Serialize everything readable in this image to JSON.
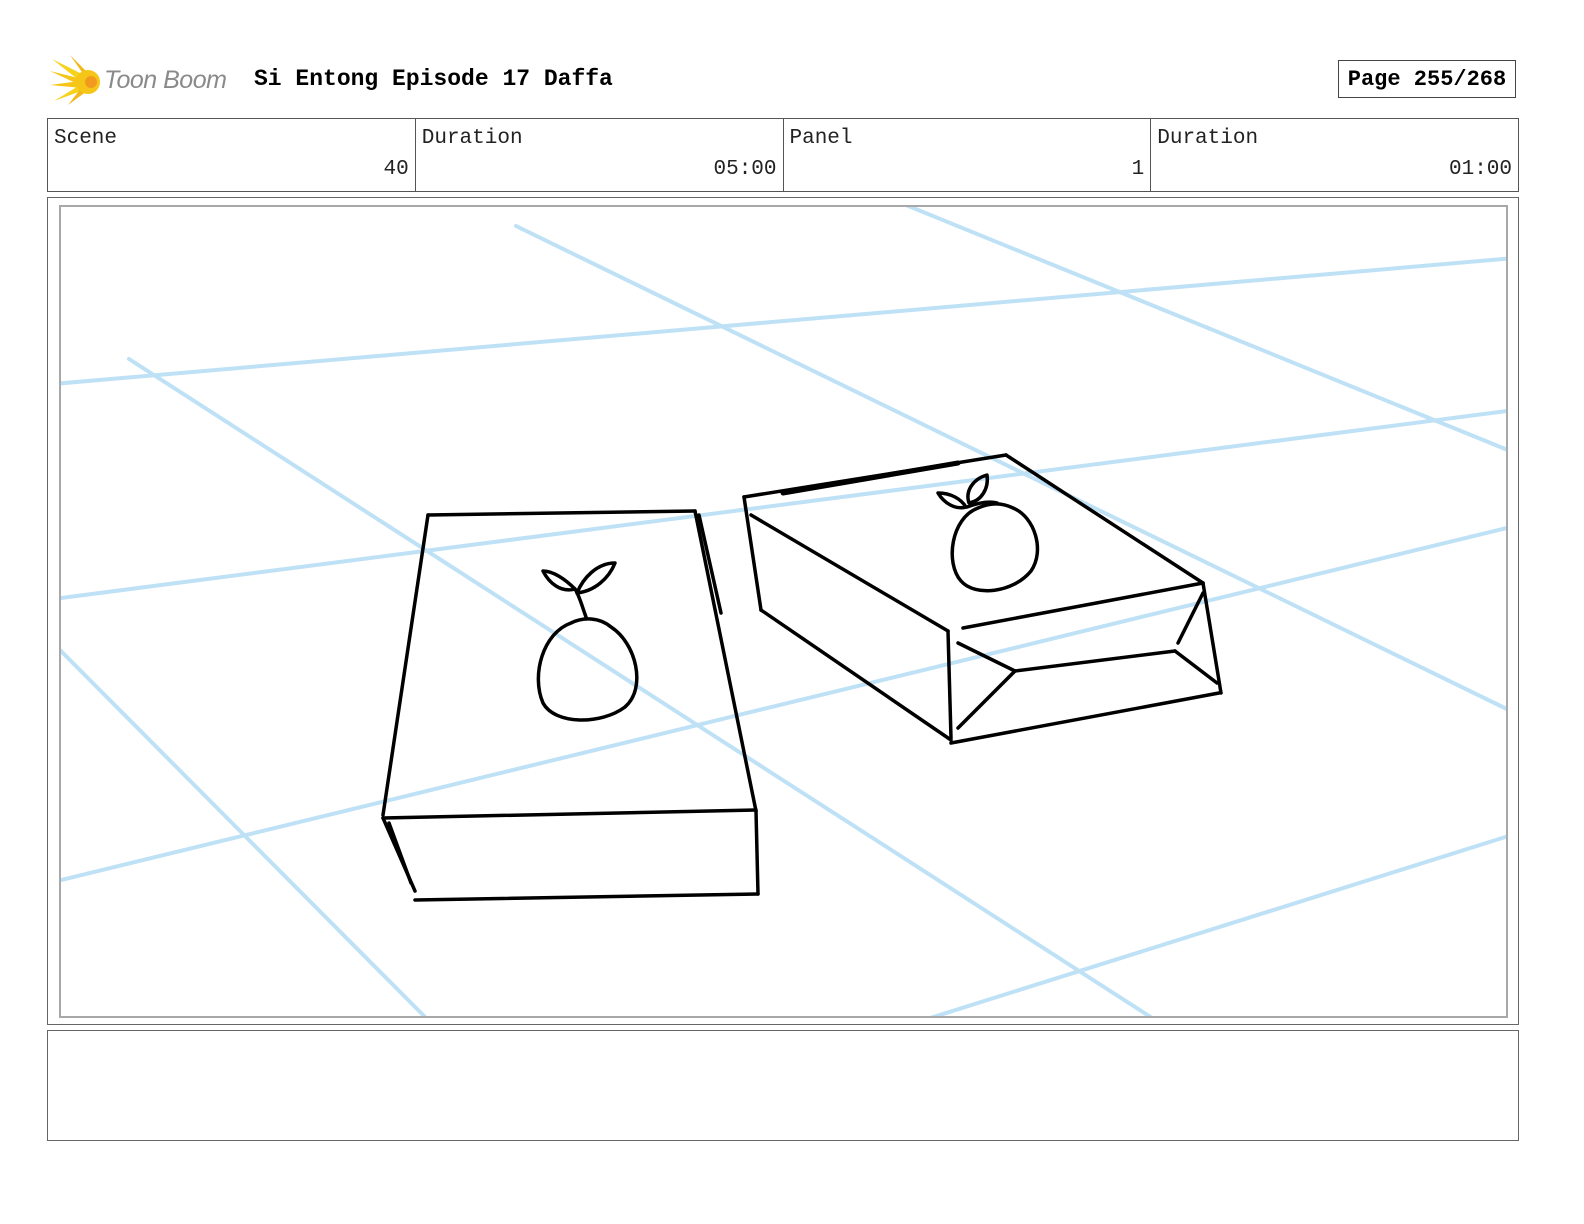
{
  "header": {
    "logo_text": "Toon Boom",
    "title": "Si Entong Episode 17 Daffa",
    "page_label": "Page 255/268"
  },
  "info": [
    {
      "label": "Scene",
      "value": "40"
    },
    {
      "label": "Duration",
      "value": "05:00"
    },
    {
      "label": "Panel",
      "value": "1"
    },
    {
      "label": "Duration",
      "value": "01:00"
    }
  ],
  "panel": {
    "sketch_subject": "two-boxes-with-fruit-logo-on-tiled-floor",
    "colors": {
      "guide_lines": "#bfe1f6",
      "ink": "#000000"
    }
  },
  "notes": {
    "text": ""
  },
  "colors": {
    "logo_yellow": "#f5c518",
    "logo_orange": "#f29a1e",
    "logo_text": "#8a8a8a"
  }
}
